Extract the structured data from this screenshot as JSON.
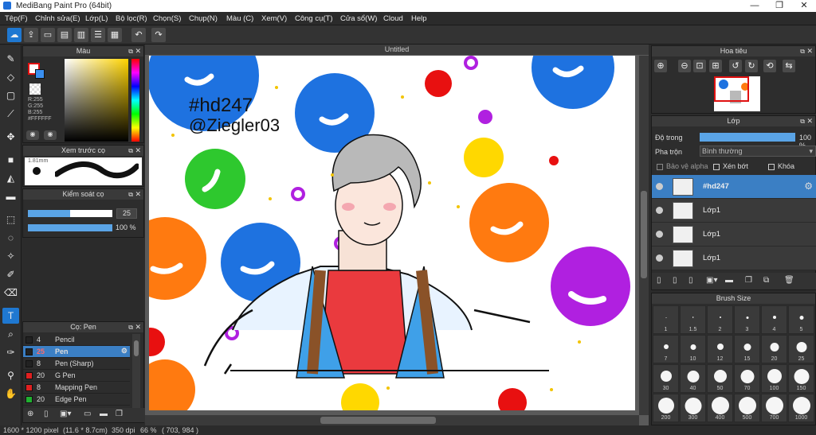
{
  "window": {
    "title": "MediBang Paint Pro (64bit)",
    "minimize": "—",
    "restore": "❐",
    "close": "✕"
  },
  "menu": [
    "Tệp(F)",
    "Chỉnh sửa(E)",
    "Lớp(L)",
    "Bộ lọc(R)",
    "Chọn(S)",
    "Chụp(N)",
    "Màu (C)",
    "Xem(V)",
    "Công cụ(T)",
    "Cửa sổ(W)",
    "Cloud",
    "Help"
  ],
  "panels": {
    "color": {
      "title": "Màu",
      "r": "R:255",
      "g": "G:255",
      "b": "B:255",
      "hex": "#FFFFFF"
    },
    "brush_preview": {
      "title": "Xem trước cọ",
      "size": "1.81mm"
    },
    "brush_control": {
      "title": "Kiểm soát cọ",
      "size_value": "25",
      "opacity_value": "100 %",
      "size_fraction": 0.5,
      "opacity_fraction": 1.0
    },
    "pens": {
      "title": "Cọ: Pen",
      "items": [
        {
          "size": "4",
          "name": "Pencil",
          "color": "#222222"
        },
        {
          "size": "25",
          "name": "Pen",
          "color": "#222222"
        },
        {
          "size": "8",
          "name": "Pen (Sharp)",
          "color": "#222222"
        },
        {
          "size": "20",
          "name": "G Pen",
          "color": "#e02020"
        },
        {
          "size": "8",
          "name": "Mapping Pen",
          "color": "#e02020"
        },
        {
          "size": "20",
          "name": "Edge Pen",
          "color": "#20b030"
        }
      ]
    },
    "navigator": {
      "title": "Hoa tiêu"
    },
    "layers": {
      "title": "Lớp",
      "opacity_label": "Độ trong",
      "opacity_value": "100 %",
      "opacity_fraction": 1.0,
      "blend_label": "Pha trộn",
      "blend_value": "Bình thường",
      "protect_alpha": "Bảo vệ alpha",
      "clipping": "Xén bớt",
      "lock": "Khóa",
      "items": [
        {
          "name": "#hd247",
          "selected": true
        },
        {
          "name": "Lớp1",
          "selected": false
        },
        {
          "name": "Lớp1",
          "selected": false
        },
        {
          "name": "Lớp1",
          "selected": false
        }
      ]
    },
    "brush_size": {
      "title": "Brush Size",
      "sizes": [
        "1",
        "1.5",
        "2",
        "3",
        "4",
        "5",
        "7",
        "10",
        "12",
        "15",
        "20",
        "25",
        "30",
        "40",
        "50",
        "70",
        "100",
        "150",
        "200",
        "300",
        "400",
        "500",
        "700",
        "1000"
      ]
    }
  },
  "canvas": {
    "tab": "Untitled",
    "hashtag": "#hd247",
    "author": "@Ziegler03"
  },
  "status": {
    "dims": "1600 * 1200 pixel",
    "cm": "(11.6 * 8.7cm)",
    "dpi": "350 dpi",
    "zoom": "66 %",
    "coords": "( 703, 984 )"
  },
  "colors": {
    "accent": "#1f78d1",
    "blue": "#1e72e0",
    "orange": "#ff7a10",
    "green": "#2ec82e",
    "purple": "#b020e0",
    "red": "#e81010",
    "yellow": "#ffd800"
  }
}
